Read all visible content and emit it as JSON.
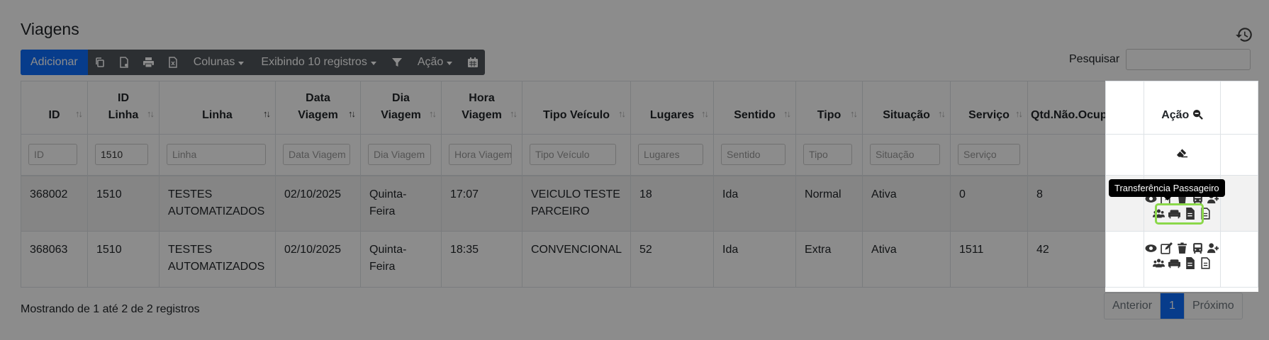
{
  "page": {
    "title": "Viagens"
  },
  "toolbar": {
    "add_label": "Adicionar",
    "columns_label": "Colunas",
    "show_label": "Exibindo 10 registros",
    "action_label": "Ação"
  },
  "search": {
    "label": "Pesquisar",
    "value": ""
  },
  "table": {
    "headers": {
      "id": "ID",
      "id_linha_1": "ID",
      "id_linha_2": "Linha",
      "linha": "Linha",
      "data_1": "Data",
      "data_2": "Viagem",
      "dia_1": "Dia",
      "dia_2": "Viagem",
      "hora_1": "Hora",
      "hora_2": "Viagem",
      "tipo_veiculo": "Tipo Veículo",
      "lugares": "Lugares",
      "sentido": "Sentido",
      "tipo": "Tipo",
      "situacao": "Situação",
      "servico": "Serviço",
      "qtd": "Qtd.Não.Ocupada",
      "acao": "Ação"
    },
    "filters": {
      "id": "ID",
      "id_linha_value": "1510",
      "linha": "Linha",
      "data": "Data Viagem",
      "dia": "Dia Viagem",
      "hora": "Hora Viagem",
      "tipo_veiculo": "Tipo Veículo",
      "lugares": "Lugares",
      "sentido": "Sentido",
      "tipo": "Tipo",
      "situacao": "Situação",
      "servico": "Serviço"
    },
    "rows": [
      {
        "id": "368002",
        "id_linha": "1510",
        "linha_1": "TESTES",
        "linha_2": "AUTOMATIZADOS",
        "data": "02/10/2025",
        "dia_1": "Quinta-",
        "dia_2": "Feira",
        "hora": "17:07",
        "tipo_veiculo_1": "VEICULO TESTE",
        "tipo_veiculo_2": "PARCEIRO",
        "lugares": "18",
        "sentido": "Ida",
        "tipo": "Normal",
        "situacao": "Ativa",
        "servico": "0",
        "qtd": "8"
      },
      {
        "id": "368063",
        "id_linha": "1510",
        "linha_1": "TESTES",
        "linha_2": "AUTOMATIZADOS",
        "data": "02/10/2025",
        "dia_1": "Quinta-",
        "dia_2": "Feira",
        "hora": "18:35",
        "tipo_veiculo_1": "CONVENCIONAL",
        "tipo_veiculo_2": "",
        "lugares": "52",
        "sentido": "Ida",
        "tipo": "Extra",
        "situacao": "Ativa",
        "servico": "1511",
        "qtd": "42"
      }
    ]
  },
  "tooltip": {
    "text": "Transferência Passageiro"
  },
  "footer": {
    "info": "Mostrando de 1 até 2 de 2 registros"
  },
  "pagination": {
    "prev": "Anterior",
    "current": "1",
    "next": "Próximo"
  }
}
